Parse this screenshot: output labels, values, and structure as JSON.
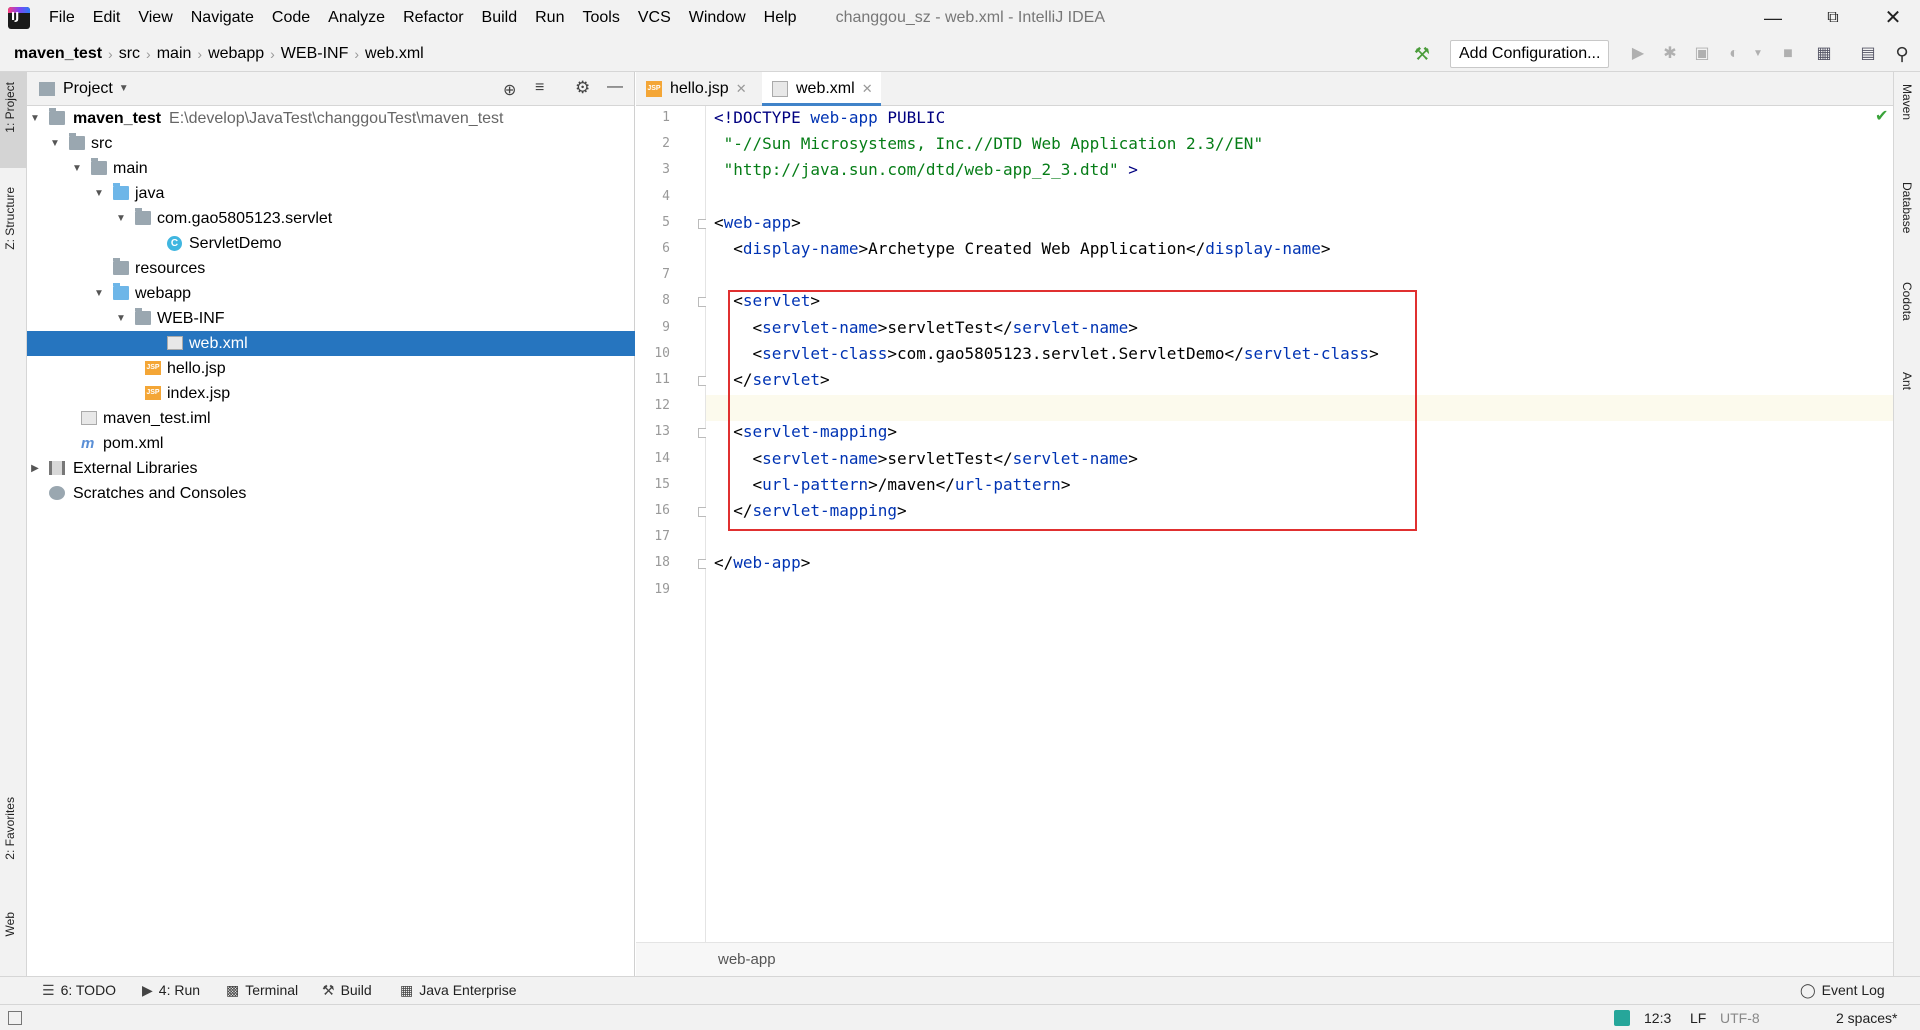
{
  "menu": {
    "items": [
      "File",
      "Edit",
      "View",
      "Navigate",
      "Code",
      "Analyze",
      "Refactor",
      "Build",
      "Run",
      "Tools",
      "VCS",
      "Window",
      "Help"
    ],
    "window_title": "changgou_sz - web.xml - IntelliJ IDEA"
  },
  "breadcrumbs": [
    "maven_test",
    "src",
    "main",
    "webapp",
    "WEB-INF",
    "web.xml"
  ],
  "toolbar": {
    "add_config": "Add Configuration..."
  },
  "left_strip": {
    "project": "1: Project",
    "structure": "Z: Structure",
    "favorites": "2: Favorites",
    "web": "Web"
  },
  "right_strip": {
    "maven": "Maven",
    "database": "Database",
    "codota": "Codota",
    "ant": "Ant"
  },
  "project_panel": {
    "title": "Project",
    "tree": [
      {
        "label": "maven_test",
        "path": "E:\\develop\\JavaTest\\changgouTest\\maven_test"
      },
      {
        "label": "src"
      },
      {
        "label": "main"
      },
      {
        "label": "java"
      },
      {
        "label": "com.gao5805123.servlet"
      },
      {
        "label": "ServletDemo"
      },
      {
        "label": "resources"
      },
      {
        "label": "webapp"
      },
      {
        "label": "WEB-INF"
      },
      {
        "label": "web.xml"
      },
      {
        "label": "hello.jsp"
      },
      {
        "label": "index.jsp"
      },
      {
        "label": "maven_test.iml"
      },
      {
        "label": "pom.xml"
      },
      {
        "label": "External Libraries"
      },
      {
        "label": "Scratches and Consoles"
      }
    ]
  },
  "editor": {
    "tabs": [
      {
        "label": "hello.jsp"
      },
      {
        "label": "web.xml"
      }
    ],
    "line_numbers": [
      "1",
      "2",
      "3",
      "4",
      "5",
      "6",
      "7",
      "8",
      "9",
      "10",
      "11",
      "12",
      "13",
      "14",
      "15",
      "16",
      "17",
      "18",
      "19"
    ],
    "lines": [
      [
        [
          "tg",
          "<!DOCTYPE "
        ],
        [
          "nm",
          "web-app"
        ],
        [
          "tg",
          " PUBLIC"
        ]
      ],
      [
        [
          "st",
          " \"-//Sun Microsystems, Inc.//DTD Web Application 2.3//EN\""
        ]
      ],
      [
        [
          "st",
          " \"http://java.sun.com/dtd/web-app_2_3.dtd\""
        ],
        [
          "tg",
          " >"
        ]
      ],
      [],
      [
        [
          "tx",
          "<"
        ],
        [
          "nm",
          "web-app"
        ],
        [
          "tx",
          ">"
        ]
      ],
      [
        [
          "tx",
          "  <"
        ],
        [
          "nm",
          "display-name"
        ],
        [
          "tx",
          ">Archetype Created Web Application</"
        ],
        [
          "nm",
          "display-name"
        ],
        [
          "tx",
          ">"
        ]
      ],
      [],
      [
        [
          "tx",
          "  <"
        ],
        [
          "nm",
          "servlet"
        ],
        [
          "tx",
          ">"
        ]
      ],
      [
        [
          "tx",
          "    <"
        ],
        [
          "nm",
          "servlet-name"
        ],
        [
          "tx",
          ">servletTest</"
        ],
        [
          "nm",
          "servlet-name"
        ],
        [
          "tx",
          ">"
        ]
      ],
      [
        [
          "tx",
          "    <"
        ],
        [
          "nm",
          "servlet-class"
        ],
        [
          "tx",
          ">com.gao5805123.servlet.ServletDemo</"
        ],
        [
          "nm",
          "servlet-class"
        ],
        [
          "tx",
          ">"
        ]
      ],
      [
        [
          "tx",
          "  </"
        ],
        [
          "nm",
          "servlet"
        ],
        [
          "tx",
          ">"
        ]
      ],
      [],
      [
        [
          "tx",
          "  <"
        ],
        [
          "nm",
          "servlet-mapping"
        ],
        [
          "tx",
          ">"
        ]
      ],
      [
        [
          "tx",
          "    <"
        ],
        [
          "nm",
          "servlet-name"
        ],
        [
          "tx",
          ">servletTest</"
        ],
        [
          "nm",
          "servlet-name"
        ],
        [
          "tx",
          ">"
        ]
      ],
      [
        [
          "tx",
          "    <"
        ],
        [
          "nm",
          "url-pattern"
        ],
        [
          "tx",
          ">/maven</"
        ],
        [
          "nm",
          "url-pattern"
        ],
        [
          "tx",
          ">"
        ]
      ],
      [
        [
          "tx",
          "  </"
        ],
        [
          "nm",
          "servlet-mapping"
        ],
        [
          "tx",
          ">"
        ]
      ],
      [],
      [
        [
          "tx",
          "</"
        ],
        [
          "nm",
          "web-app"
        ],
        [
          "tx",
          ">"
        ]
      ],
      []
    ],
    "footer_breadcrumb": "web-app"
  },
  "tool_windows": [
    {
      "label": "6: TODO",
      "icon": "todo-icon"
    },
    {
      "label": "4: Run",
      "icon": "run-icon"
    },
    {
      "label": "Terminal",
      "icon": "terminal-icon"
    },
    {
      "label": "Build",
      "icon": "build-icon"
    },
    {
      "label": "Java Enterprise",
      "icon": "java-enterprise-icon"
    }
  ],
  "event_log": "Event Log",
  "status": {
    "position": "12:3",
    "line_sep": "LF",
    "encoding": "UTF-8",
    "indent": "2 spaces*"
  },
  "colors": {
    "selection": "#2675bf",
    "highlight_box": "#e03030",
    "tag": "#0033b3",
    "string": "#067d17"
  }
}
